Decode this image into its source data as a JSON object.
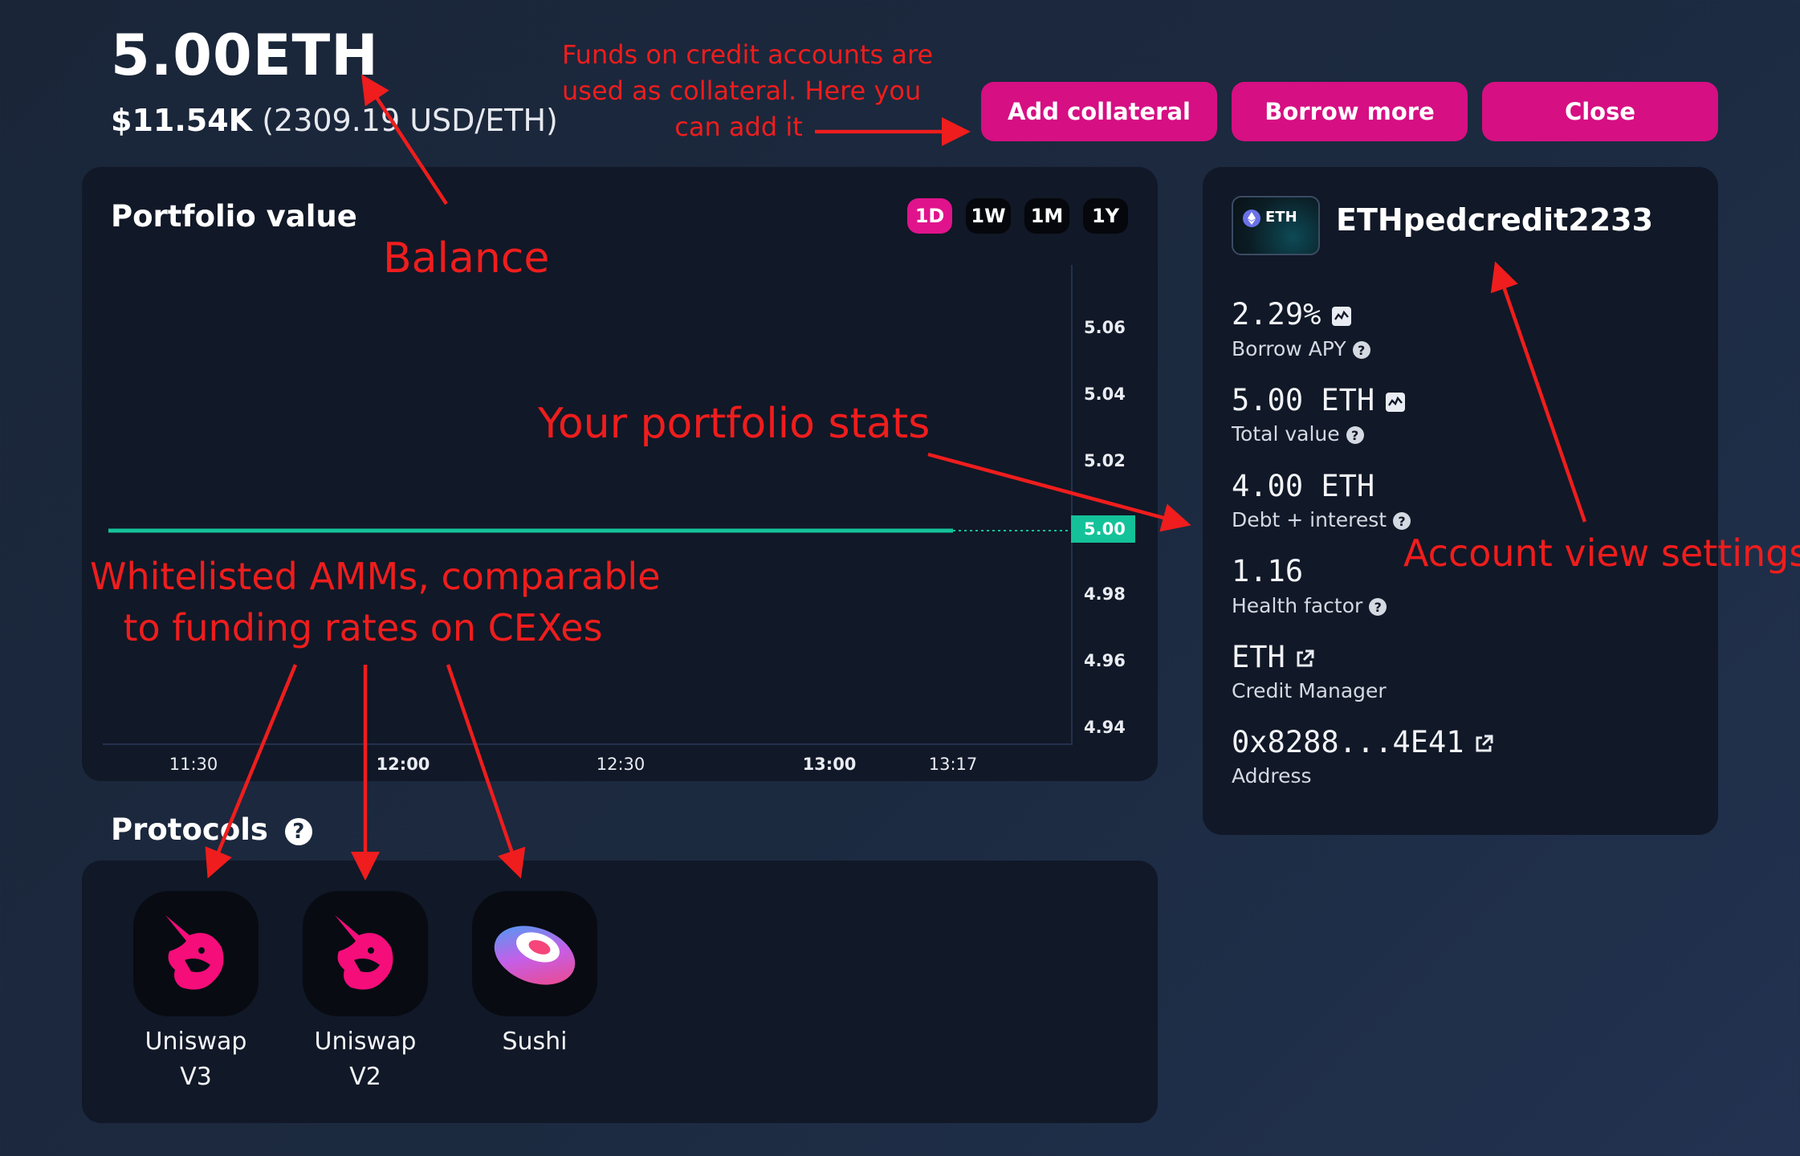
{
  "header": {
    "balance": "5.00ETH",
    "usd_value": "$11.54K",
    "rate": "(2309.19 USD/ETH)"
  },
  "actions": {
    "add_collateral": "Add collateral",
    "borrow_more": "Borrow more",
    "close": "Close"
  },
  "portfolio": {
    "title": "Portfolio value",
    "ranges": [
      "1D",
      "1W",
      "1M",
      "1Y"
    ],
    "active_range": "1D",
    "y_ticks": [
      "5.06",
      "5.04",
      "5.02",
      "4.98",
      "4.96",
      "4.94"
    ],
    "x_ticks": [
      "11:30",
      "12:00",
      "12:30",
      "13:00",
      "13:17"
    ],
    "current_value": "5.00"
  },
  "chart_data": {
    "type": "line",
    "x": [
      "11:30",
      "12:00",
      "12:30",
      "13:00",
      "13:17"
    ],
    "series": [
      {
        "values": [
          5.0,
          5.0,
          5.0,
          5.0,
          5.0
        ]
      }
    ],
    "ylim": [
      4.93,
      5.07
    ],
    "y_ticks": [
      4.94,
      4.96,
      4.98,
      5.0,
      5.02,
      5.04,
      5.06
    ],
    "current": 5.0,
    "colors": {
      "line": "#14c29a",
      "label_bg": "#14c29a"
    }
  },
  "account": {
    "token_badge": "ETH",
    "name": "ETHpedcredit2233",
    "stats": [
      {
        "value": "2.29%",
        "label": "Borrow APY"
      },
      {
        "value": "5.00 ETH",
        "label": "Total value"
      },
      {
        "value": "4.00 ETH",
        "label": "Debt + interest"
      },
      {
        "value": "1.16",
        "label": "Health factor"
      },
      {
        "value": "ETH",
        "label": "Credit Manager"
      },
      {
        "value": "0x8288...4E41",
        "label": "Address"
      }
    ]
  },
  "protocols": {
    "title": "Protocols",
    "items": [
      {
        "line1": "Uniswap",
        "line2": "V3",
        "icon": "uniswap-unicorn-icon"
      },
      {
        "line1": "Uniswap",
        "line2": "V2",
        "icon": "uniswap-unicorn-icon"
      },
      {
        "line1": "Sushi",
        "line2": "",
        "icon": "sushi-icon"
      }
    ]
  },
  "annotations": {
    "collateral_note": [
      "Funds on credit accounts are",
      "used as collateral. Here you",
      "can add it"
    ],
    "balance": "Balance",
    "portfolio_stats": "Your portfolio stats",
    "account_settings": "Account view settings",
    "amms": [
      "Whitelisted AMMs, comparable",
      "to funding rates on CEXes"
    ]
  },
  "colors": {
    "accent": "#d60f83",
    "background": "#1c2a40",
    "panel": "#111827",
    "line": "#14c29a",
    "annotation": "#ef1d1d"
  }
}
